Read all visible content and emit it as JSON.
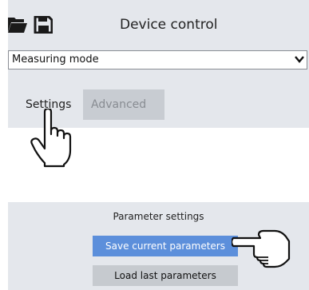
{
  "header": {
    "title": "Device control",
    "icons": [
      "folder-icon",
      "save-disk-icon"
    ]
  },
  "mode_select": {
    "selected": "Measuring mode",
    "icon": "chevron-down-icon"
  },
  "tabs": [
    {
      "label": "Settings",
      "active": true
    },
    {
      "label": "Advanced",
      "active": false
    }
  ],
  "parameters": {
    "heading": "Parameter settings",
    "save_label": "Save current parameters",
    "load_label": "Load last parameters"
  },
  "colors": {
    "panel_bg": "#e4e7ec",
    "primary_button": "#5c8fdb",
    "secondary_button": "#c6cacf",
    "inactive_tab": "#c8ccd2"
  },
  "cursors": [
    "hand-pointer-icon",
    "hand-pointing-right-icon"
  ]
}
